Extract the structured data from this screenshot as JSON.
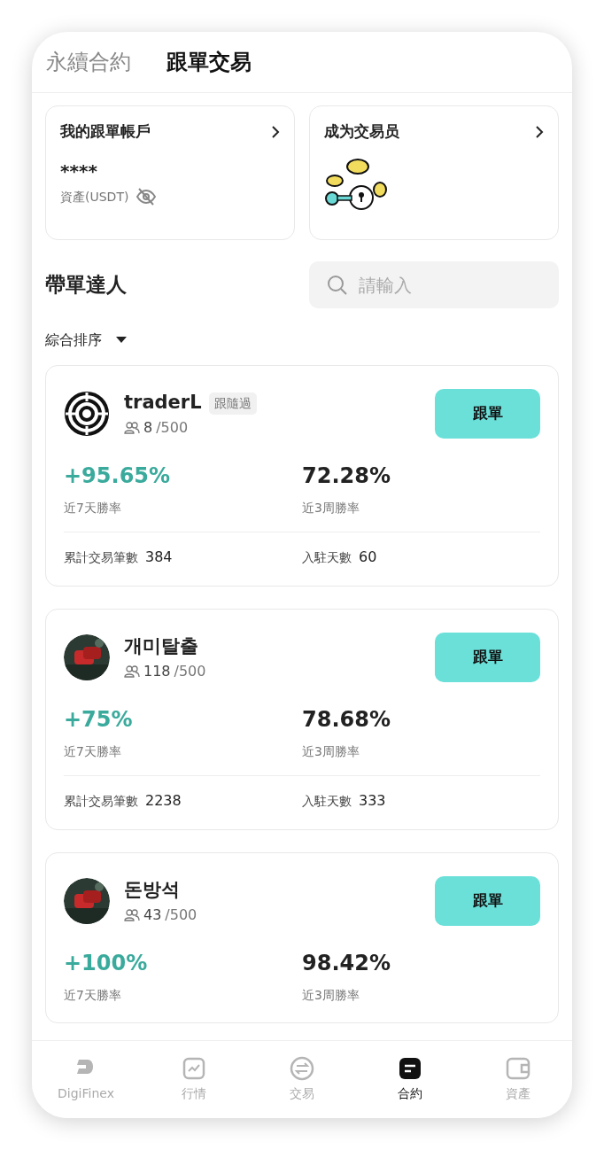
{
  "tabs": [
    {
      "label": "永續合約",
      "selected": false
    },
    {
      "label": "跟單交易",
      "selected": true
    }
  ],
  "account_card": {
    "title": "我的跟單帳戶",
    "balance": "****",
    "balance_label": "資產(USDT)"
  },
  "trader_card": {
    "title": "成为交易员"
  },
  "section": {
    "title": "帶單達人",
    "search": {
      "placeholder": "請輸入"
    }
  },
  "sort": {
    "label": "綜合排序"
  },
  "traders": [
    {
      "kind": "logo",
      "name": "traderL",
      "badge": "跟隨過",
      "followers": "8",
      "capacity": "/500",
      "button": "跟單",
      "roi": "+95.65%",
      "roi_label": "近7天勝率",
      "win_rate": "72.28%",
      "win_label": "近3周勝率",
      "trades_label": "累計交易筆數",
      "trades": "384",
      "days_label": "入駐天數",
      "days": "60"
    },
    {
      "name": "개미탈출",
      "followers": "118",
      "capacity": "/500",
      "button": "跟單",
      "roi": "+75%",
      "roi_label": "近7天勝率",
      "win_rate": "78.68%",
      "win_label": "近3周勝率",
      "trades_label": "累計交易筆數",
      "trades": "2238",
      "days_label": "入駐天數",
      "days": "333"
    },
    {
      "name": "돈방석",
      "followers": "43",
      "capacity": "/500",
      "button": "跟單",
      "roi": "+100%",
      "roi_label": "近7天勝率",
      "win_rate": "98.42%",
      "win_label": "近3周勝率"
    }
  ],
  "bottom_nav": [
    {
      "label": "DigiFinex",
      "selected": false
    },
    {
      "label": "行情",
      "selected": false
    },
    {
      "label": "交易",
      "selected": false
    },
    {
      "label": "合約",
      "selected": true
    },
    {
      "label": "資產",
      "selected": false
    }
  ]
}
